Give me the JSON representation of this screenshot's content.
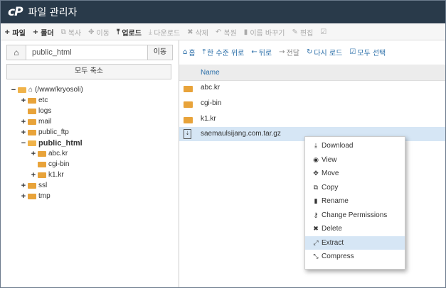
{
  "app": {
    "logo": "cP",
    "title": "파일 관리자"
  },
  "toolbar": {
    "items": [
      {
        "icon": "+",
        "label": "파일",
        "enabled": true
      },
      {
        "icon": "+",
        "label": "폴더",
        "enabled": true
      },
      {
        "icon": "⧉",
        "label": "복사",
        "enabled": false
      },
      {
        "icon": "✥",
        "label": "이동",
        "enabled": false
      },
      {
        "icon": "⤒",
        "label": "업로드",
        "enabled": true
      },
      {
        "icon": "⤓",
        "label": "다운로드",
        "enabled": false
      },
      {
        "icon": "✖",
        "label": "삭제",
        "enabled": false
      },
      {
        "icon": "↶",
        "label": "복원",
        "enabled": false
      },
      {
        "icon": "▮",
        "label": "이름 바꾸기",
        "enabled": false
      },
      {
        "icon": "✎",
        "label": "편집",
        "enabled": false
      },
      {
        "icon": "☑",
        "label": "",
        "enabled": false
      }
    ]
  },
  "sidebar": {
    "path_value": "public_html",
    "go_label": "이동",
    "collapse_label": "모두 축소",
    "tree": [
      {
        "toggle": "−",
        "label": "(/www/kryosoli)",
        "home": true,
        "bold": false
      },
      {
        "toggle": "+",
        "label": "etc",
        "bold": false
      },
      {
        "toggle": "",
        "label": "logs",
        "bold": false
      },
      {
        "toggle": "+",
        "label": "mail",
        "bold": false
      },
      {
        "toggle": "+",
        "label": "public_ftp",
        "bold": false
      },
      {
        "toggle": "−",
        "label": "public_html",
        "bold": true
      },
      {
        "toggle": "+",
        "label": "abc.kr",
        "bold": false
      },
      {
        "toggle": "",
        "label": "cgi-bin",
        "bold": false
      },
      {
        "toggle": "+",
        "label": "k1.kr",
        "bold": false
      },
      {
        "toggle": "+",
        "label": "ssl",
        "bold": false
      },
      {
        "toggle": "+",
        "label": "tmp",
        "bold": false
      }
    ]
  },
  "nav": {
    "items": [
      {
        "icon": "⌂",
        "label": "홈"
      },
      {
        "icon": "⤒",
        "label": "한 수준 위로"
      },
      {
        "icon": "←",
        "label": "뒤로"
      },
      {
        "icon": "→",
        "label": "전달"
      },
      {
        "icon": "↻",
        "label": "다시 로드"
      },
      {
        "icon": "☑",
        "label": "모두 선택"
      }
    ]
  },
  "files": {
    "column_name": "Name",
    "rows": [
      {
        "name": "abc.kr",
        "type": "folder",
        "selected": false
      },
      {
        "name": "cgi-bin",
        "type": "folder",
        "selected": false
      },
      {
        "name": "k1.kr",
        "type": "folder",
        "selected": false
      },
      {
        "name": "saemaulsijang.com.tar.gz",
        "type": "archive",
        "selected": true
      }
    ]
  },
  "context_menu": {
    "items": [
      {
        "icon": "⤓",
        "label": "Download",
        "highlighted": false
      },
      {
        "icon": "◉",
        "label": "View",
        "highlighted": false
      },
      {
        "icon": "✥",
        "label": "Move",
        "highlighted": false
      },
      {
        "icon": "⧉",
        "label": "Copy",
        "highlighted": false
      },
      {
        "icon": "▮",
        "label": "Rename",
        "highlighted": false
      },
      {
        "icon": "⚷",
        "label": "Change Permissions",
        "highlighted": false
      },
      {
        "icon": "✖",
        "label": "Delete",
        "highlighted": false
      },
      {
        "icon": "⤢",
        "label": "Extract",
        "highlighted": true
      },
      {
        "icon": "⤡",
        "label": "Compress",
        "highlighted": false
      }
    ]
  }
}
